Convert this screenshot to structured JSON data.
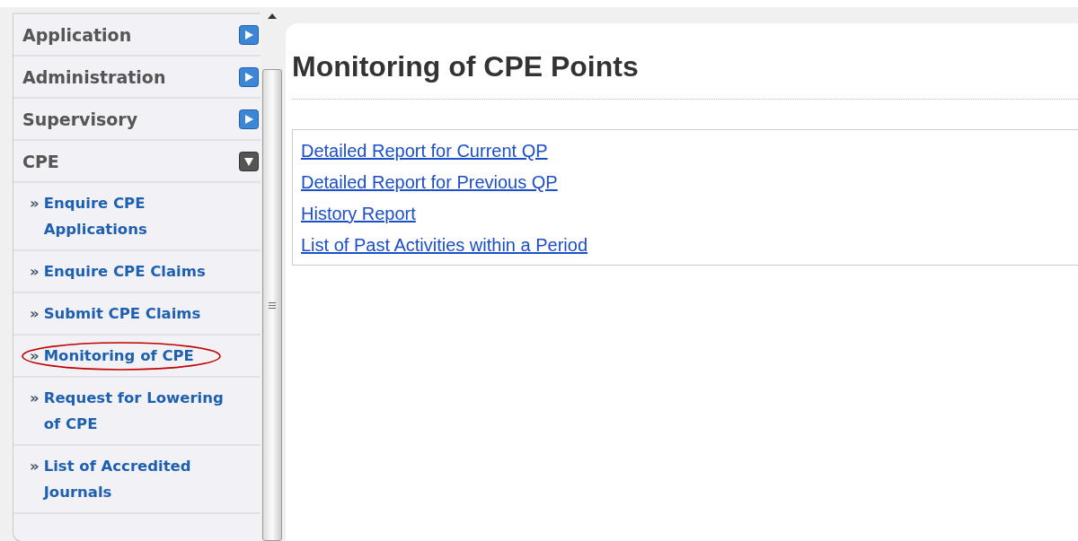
{
  "sidebar": {
    "items": [
      {
        "label": "Application",
        "expanded": false
      },
      {
        "label": "Administration",
        "expanded": false
      },
      {
        "label": "Supervisory",
        "expanded": false
      },
      {
        "label": "CPE",
        "expanded": true,
        "children": [
          {
            "label": "Enquire CPE Applications",
            "highlighted": false
          },
          {
            "label": "Enquire CPE Claims",
            "highlighted": false
          },
          {
            "label": "Submit CPE Claims",
            "highlighted": false
          },
          {
            "label": "Monitoring of CPE",
            "highlighted": true
          },
          {
            "label": "Request for Lowering of CPE",
            "highlighted": false
          },
          {
            "label": "List of Accredited Journals",
            "highlighted": false
          }
        ]
      }
    ]
  },
  "bullet": "»",
  "page": {
    "title": "Monitoring of CPE Points",
    "links": [
      "Detailed Report for Current QP",
      "Detailed Report for Previous QP",
      "History Report",
      "List of Past Activities within a Period"
    ]
  }
}
